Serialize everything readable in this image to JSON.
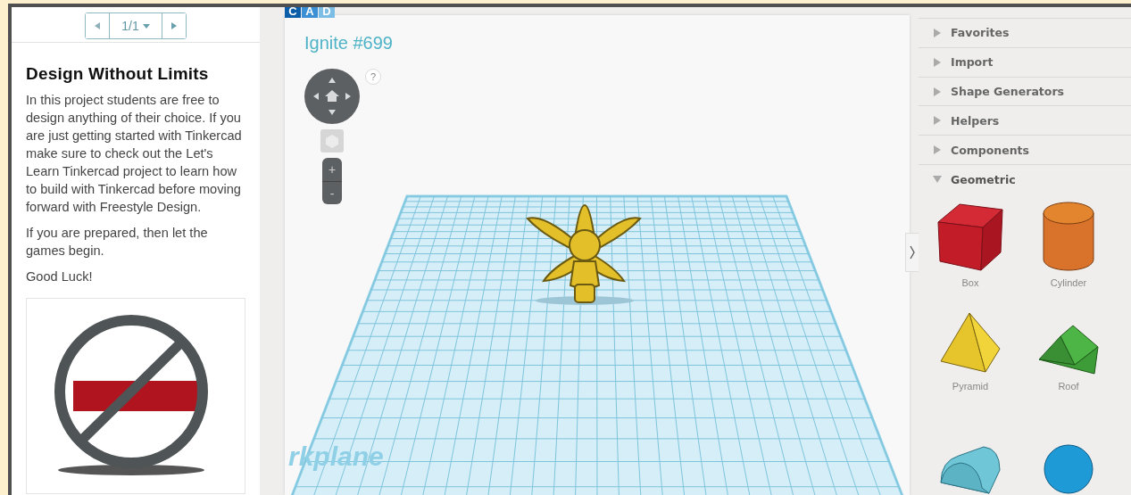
{
  "pager": {
    "label": "1/1"
  },
  "lesson": {
    "title": "Design Without Limits",
    "paragraphs": [
      "In this project students are free to design anything of their choice. If you are just getting started with Tinkercad make sure to check out the Let's Learn Tinkercad project to learn how to build with Tinkercad before moving forward with Freestyle Design.",
      "If you are prepared, then let the games begin.",
      "Good Luck!"
    ]
  },
  "badge": [
    "C",
    "A",
    "D"
  ],
  "design": {
    "title": "Ignite #699",
    "help": "?",
    "zoom_in": "+",
    "zoom_out": "-",
    "workplane_label": "rkplane"
  },
  "library": {
    "sections": [
      {
        "label": "Favorites",
        "expanded": false
      },
      {
        "label": "Import",
        "expanded": false
      },
      {
        "label": "Shape Generators",
        "expanded": false
      },
      {
        "label": "Helpers",
        "expanded": false
      },
      {
        "label": "Components",
        "expanded": false
      },
      {
        "label": "Geometric",
        "expanded": true
      }
    ],
    "shapes": [
      {
        "kind": "box",
        "label": "Box"
      },
      {
        "kind": "cylinder",
        "label": "Cylinder"
      },
      {
        "kind": "pyramid",
        "label": "Pyramid"
      },
      {
        "kind": "roof",
        "label": "Roof"
      },
      {
        "kind": "round-roof"
      },
      {
        "kind": "sphere"
      }
    ]
  }
}
